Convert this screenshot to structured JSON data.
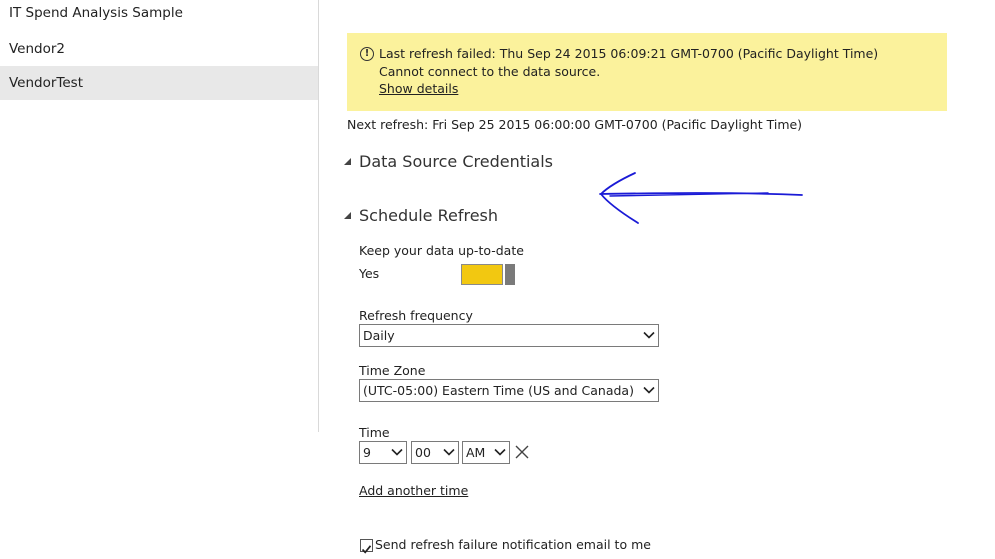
{
  "sidebar": {
    "items": [
      {
        "label": "IT Spend Analysis Sample"
      },
      {
        "label": "Vendor2"
      },
      {
        "label": "VendorTest"
      }
    ]
  },
  "warning": {
    "line1": "Last refresh failed: Thu Sep 24 2015 06:09:21 GMT-0700 (Pacific Daylight Time)",
    "line2": "Cannot connect to the data source.",
    "link": "Show details"
  },
  "next_refresh": "Next refresh: Fri Sep 25 2015 06:00:00 GMT-0700 (Pacific Daylight Time)",
  "sections": {
    "credentials": "Data Source Credentials",
    "schedule": "Schedule Refresh"
  },
  "schedule": {
    "keep_label": "Keep your data up-to-date",
    "toggle_value": "Yes",
    "toggle_on": true,
    "frequency_label": "Refresh frequency",
    "frequency_value": "Daily",
    "timezone_label": "Time Zone",
    "timezone_value": "(UTC-05:00) Eastern Time (US and Canada)",
    "time_label": "Time",
    "hour": "9",
    "minute": "00",
    "ampm": "AM",
    "add_time": "Add another time",
    "notify_label": "Send refresh failure notification email to me",
    "notify_checked": true
  },
  "colors": {
    "warning_bg": "#fbf29c",
    "toggle_on": "#f2c811",
    "selected_bg": "#e8e8e8",
    "annotation": "#1a1ad6"
  }
}
